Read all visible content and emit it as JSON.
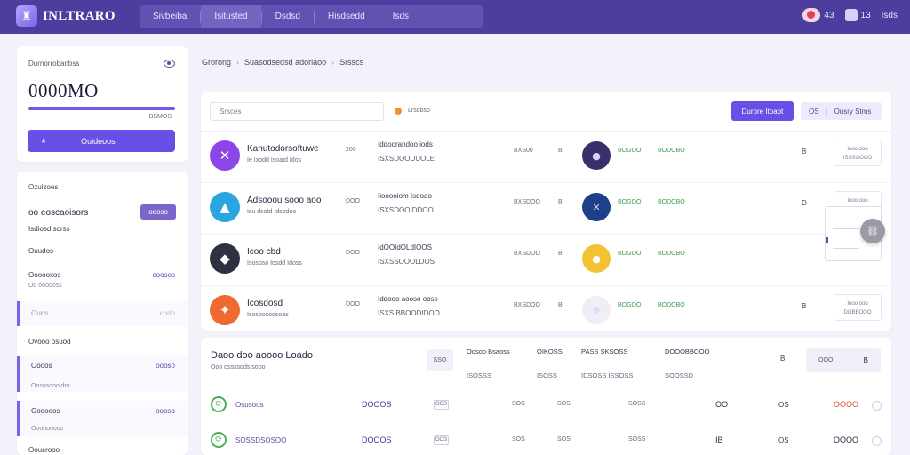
{
  "app": {
    "title": "INLTRARO",
    "logo_glyph": "♜"
  },
  "topnav": {
    "items": [
      "Sivbeiba",
      "Isitusted",
      "Dsdsd",
      "Hisdsedd",
      "Isds"
    ]
  },
  "topright": {
    "flag_count": "43",
    "bell_count": "13",
    "user": "Isds"
  },
  "balance": {
    "label": "Durnorrobanbss",
    "value": "0000MO",
    "bar_fraction": 1.0,
    "sub": "BSMOS",
    "deposit_label": "Ouideoos"
  },
  "sidebar": {
    "title": "Ozuizoes",
    "rows": [
      {
        "label": "oo eoscaoisors",
        "tag": "oooso"
      },
      {
        "label": "Isdiosd sorss"
      },
      {
        "label": "Ouudos"
      },
      {
        "label": "Oooooxos",
        "value": "coosos",
        "sub": "Oo oooooss"
      },
      {
        "label": "Ouos",
        "value": "codo"
      },
      {
        "label": "Ovooo osuod"
      },
      {
        "label": "Oooos",
        "value": "oooso",
        "sub": "Oososoooidro"
      },
      {
        "label": "Oooooos",
        "value": "oooso",
        "sub": "Oooooooos"
      },
      {
        "label": "Oousrooo"
      }
    ]
  },
  "breadcrumb": [
    "Grorong",
    "Suasodsedsd adorlaoo",
    "Srsscs"
  ],
  "panel": {
    "search_placeholder": "Srsces",
    "filter_label": "Lrsdbso",
    "primary_label": "Durore Itoabt",
    "secondary_a": "OS",
    "secondary_b": "Ousry Stms",
    "rows": [
      {
        "name": "Kanutodorsoftuwe",
        "sub": "Ie Ixodd Isoatd Idos",
        "qty": "200",
        "title2": "Iddoorandoo iods",
        "sub2": "ISXSDOOUUOLE",
        "p1": "BXS00",
        "p2": "B",
        "g1": "BOGOO",
        "g2": "BODOBO",
        "end": "B",
        "box": "Iooo ooo\nISSSGOOO",
        "icon_color": "#8a46e6",
        "icon_glyph": "✕",
        "coin_color": "#3a2f6a",
        "coin_glyph": "●"
      },
      {
        "name": "Adsooou sooo aoo",
        "sub": "Isu dsotd Idsodoo",
        "qty": "DOO",
        "title2": "Iiooooiom Isdoao",
        "sub2": "ISXSDOOIDDOO",
        "p1": "BXSDOO",
        "p2": "B",
        "g1": "BOGOO",
        "g2": "BODOBO",
        "end": "D",
        "box": "Iooo ooo",
        "icon_color": "#29a6e0",
        "icon_glyph": "▲",
        "coin_color": "#1e3f8a",
        "coin_glyph": "✕"
      },
      {
        "name": "Icoo cbd",
        "sub": "Isososo Iosdd Idoss",
        "qty": "DOO",
        "title2": "IdOOIdOLdIOOS",
        "sub2": "ISXSSOOOLDOS",
        "p1": "BXSDOO",
        "p2": "B",
        "g1": "BOGOO",
        "g2": "BODOBO",
        "end": "",
        "box": "",
        "icon_color": "#2e3140",
        "icon_glyph": "◆",
        "coin_color": "#f2c233",
        "coin_glyph": "●"
      },
      {
        "name": "Icosdosd",
        "sub": "Isosoosoosoas",
        "qty": "DOO",
        "title2": "Iddooo aooso ooss",
        "sub2": "ISXSIBBOODIDOO",
        "p1": "BXSDOO",
        "p2": "B",
        "g1": "BOGOO",
        "g2": "BODOBO",
        "end": "B",
        "box": "Iooo ooo\nDOBBOOO",
        "icon_color": "#ee6a2e",
        "icon_glyph": "✦",
        "coin_color": "#eeeef4",
        "coin_glyph": "❖"
      }
    ]
  },
  "bottom": {
    "title": "Daoo doo aoooo Loado",
    "sub": "Ooo ossssdds sooo",
    "chip": "SSO",
    "headers": [
      {
        "a": "Oosoo Bsaoss",
        "b": "ISOSSS"
      },
      {
        "a": "OIKOSS",
        "b": "ISOSS"
      },
      {
        "a": "PASS SKSOSS",
        "b": "IDSOSS ISSOSS"
      },
      {
        "a": "DOOOBBOOO",
        "b": "SOOSSD"
      }
    ],
    "circle": "B",
    "field_a": "OOO",
    "field_b": "B",
    "rows": [
      {
        "name": "Osusoos",
        "amount": "DOOOS",
        "mini": "OOS",
        "c1": "SOS",
        "c2": "SOS",
        "c3": "SOSS",
        "val": "OO",
        "val2": "OS",
        "end": "OOOO",
        "end_color": "#e0502f"
      },
      {
        "name": "SOSSDSOSOO",
        "amount": "DOOOS",
        "mini": "OOS",
        "c1": "SOS",
        "c2": "SOS",
        "c3": "SOSS",
        "val": "IB",
        "val2": "OS",
        "end": "OOOO",
        "end_color": "#2a2840"
      }
    ]
  }
}
